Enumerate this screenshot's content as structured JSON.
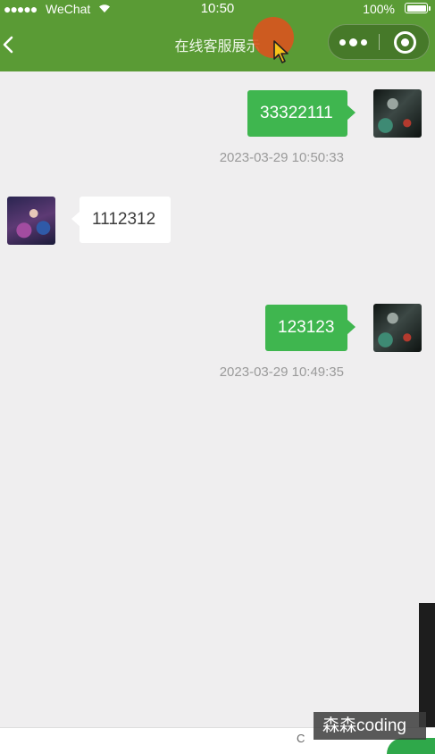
{
  "status_bar": {
    "signal": "●●●●●",
    "carrier": "WeChat",
    "time": "10:50",
    "battery_percent": "100%"
  },
  "nav": {
    "title": "在线客服展示"
  },
  "messages": [
    {
      "from": "me",
      "text": "33322111",
      "timestamp": "2023-03-29 10:50:33"
    },
    {
      "from": "other",
      "text": "1112312"
    },
    {
      "from": "me",
      "text": "123123",
      "timestamp": "2023-03-29 10:49:35"
    }
  ],
  "bottom": {
    "partial_text": "C"
  },
  "watermark": "森森coding",
  "icons": {
    "back": "chevron-left-icon",
    "more": "more-dots-icon",
    "close": "capsule-close-icon",
    "wifi": "wifi-icon",
    "battery": "battery-icon",
    "cursor": "mouse-cursor-icon"
  },
  "colors": {
    "header_bg": "#5a9b35",
    "chat_bg": "#efeeef",
    "my_bubble": "#3fb64f",
    "other_bubble": "#ffffff",
    "timestamp_text": "#9a9a9a",
    "click_indicator": "#d9541e"
  }
}
